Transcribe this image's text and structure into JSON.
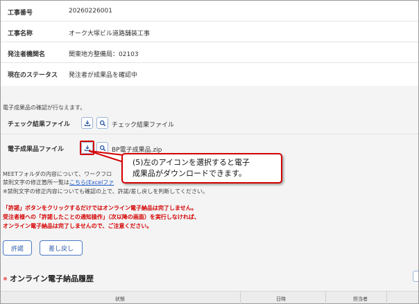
{
  "info": {
    "rows": [
      {
        "label": "工事番号",
        "value": "20260226001"
      },
      {
        "label": "工事名称",
        "value": "オーク大塚ビル道路舗装工事"
      },
      {
        "label": "発注者機関名",
        "value": "関東地方整備局：02103"
      },
      {
        "label": "現在のステータス",
        "value": "発注者が成果品を確認中"
      }
    ]
  },
  "notice": "電子成果品の確認が行なえます。",
  "files": {
    "check_label": "チェック結果ファイル",
    "check_filename": "チェック結果ファイル",
    "deliverable_label": "電子成果品ファイル",
    "deliverable_filename": "BP電子成果品.zip"
  },
  "callout": {
    "line1": "(5)左のアイコンを選択すると電子",
    "line2": "成果品がダウンロードできます。"
  },
  "meet": {
    "line1": "MEETフォルダの内容について、ワークフロ",
    "line2_prefix": "禁則文字の修正箇所一覧は",
    "line2_link": "こちら(Excelファ",
    "line3": "※禁則文字の修正内容についても確認の上で、許諾/差し戻しを判断してください。"
  },
  "warning": {
    "line1": "「許諾」ボタンをクリックするだけではオンライン電子納品は完了しません。",
    "line2": "受注者様への「許諾したことの通知操作」（次以降の画面）を実行しなければ、",
    "line3": "オンライン電子納品は完了しませんので、ご注意ください。"
  },
  "buttons": {
    "approve": "許諾",
    "send_back": "差し戻し"
  },
  "history": {
    "title": "オンライン電子納品履歴",
    "columns": [
      "状態",
      "日時",
      "担当者"
    ]
  },
  "icons": {
    "download": "download-icon",
    "preview": "magnifier-icon"
  },
  "colors": {
    "accent": "#2c5aa8",
    "warning": "#d40000",
    "highlight": "#d40000"
  }
}
